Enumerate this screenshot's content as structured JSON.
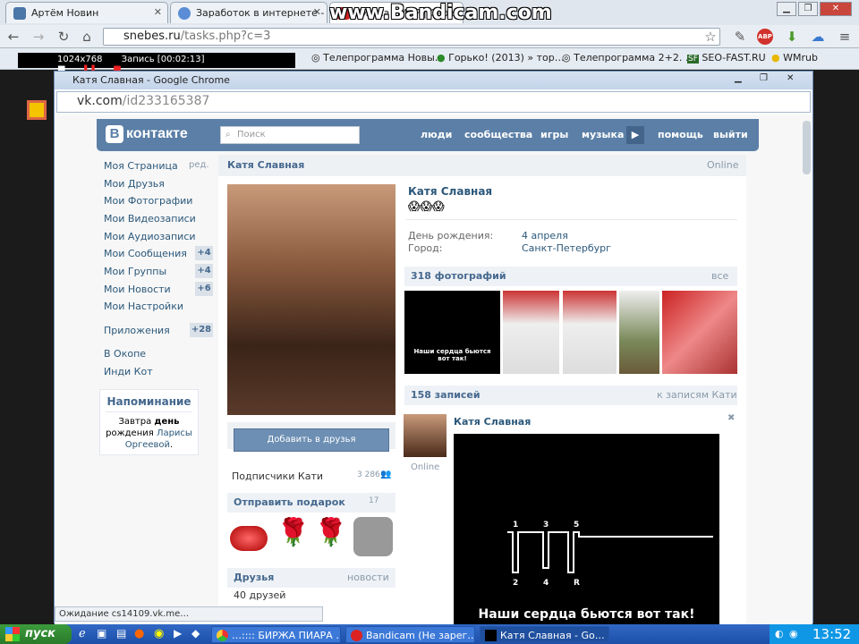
{
  "browser": {
    "tabs": [
      {
        "title": "Артём Новин"
      },
      {
        "title": "Заработок в интернете - Р"
      },
      {
        "title": "Биржа ПИАР | Свое"
      }
    ],
    "url_host": "snebes.ru",
    "url_path": "/tasks.php?c=3",
    "watermark": "www.Bandicam.com",
    "bookmarks": [
      "Телепрограмма Новы…",
      "Горько! (2013) » тор…",
      "Телепрограмма 2+2. …",
      "SEO-FAST.RU",
      "WMrub"
    ],
    "recorder": {
      "resolution": "1024x768",
      "recording": "Запись [00:02:13]"
    },
    "status": "Ожидание cs14109.vk.me…"
  },
  "inner": {
    "title": "Катя Славная - Google Chrome",
    "url_host": "vk.com",
    "url_path": "/id233165387"
  },
  "vk": {
    "logo_text": "контакте",
    "logo_letter": "В",
    "search_placeholder": "Поиск",
    "nav": [
      "люди",
      "сообщества",
      "игры",
      "музыка",
      "помощь",
      "выйти"
    ],
    "menu": [
      {
        "label": "Моя Страница",
        "extra": "ред."
      },
      {
        "label": "Мои Друзья"
      },
      {
        "label": "Мои Фотографии"
      },
      {
        "label": "Мои Видеозаписи"
      },
      {
        "label": "Мои Аудиозаписи"
      },
      {
        "label": "Мои Сообщения",
        "badge": "+4"
      },
      {
        "label": "Мои Группы",
        "badge": "+4"
      },
      {
        "label": "Мои Новости",
        "badge": "+6"
      },
      {
        "label": "Мои Настройки"
      },
      {
        "label": "Приложения",
        "badge": "+28"
      },
      {
        "label": "В Окопе"
      },
      {
        "label": "Инди Кот"
      }
    ],
    "reminder": {
      "title": "Напоминание",
      "text1": "Завтра ",
      "bold": "день",
      "text2": "рождения ",
      "link": "Ларисы Оргеевой",
      "dot": "."
    },
    "profile": {
      "header_name": "Катя Славная",
      "header_status": "Online",
      "name": "Катя Славная",
      "status_emoji": "😱😱😱",
      "birthday_label": "День рождения:",
      "birthday": "4 апреля",
      "city_label": "Город:",
      "city": "Санкт-Петербург",
      "add_friend": "Добавить в друзья",
      "subscribers_label": "Подписчики Кати",
      "subscribers_count": "3 286",
      "gift_label": "Отправить подарок",
      "gift_count": "17",
      "friends_label": "Друзья",
      "friends_new": "новости",
      "friends_count": "40 друзей",
      "photos_label": "318 фотографий",
      "photos_all": "все",
      "photo_caption": "Наши сердца бьются вот так!",
      "posts_label": "158 записей",
      "posts_link": "к записям Кати",
      "post_author": "Катя Славная",
      "post_online": "Online",
      "ecg_labels": [
        "1",
        "3",
        "5",
        "2",
        "4",
        "R"
      ],
      "post_caption": "Наши сердца бьются вот так!"
    }
  },
  "taskbar": {
    "start": "пуск",
    "items": [
      "…:::: БИРЖА ПИАРА …",
      "Bandicam (Не зарег…",
      "Катя Славная - Go…"
    ],
    "clock": "13:52"
  }
}
